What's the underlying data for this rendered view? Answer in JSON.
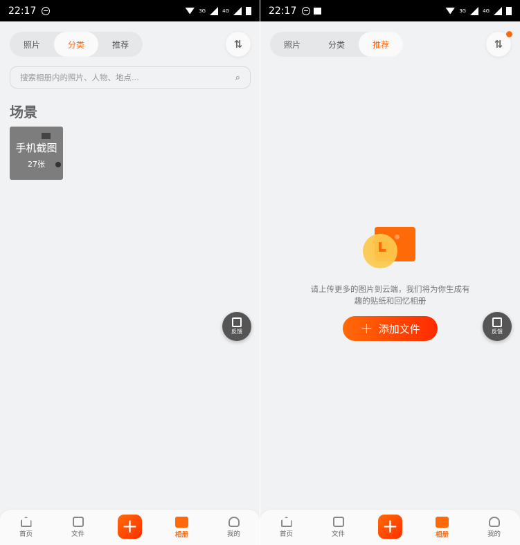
{
  "status": {
    "time": "22:17",
    "net1": "3G",
    "net2": "4G"
  },
  "tabs": [
    "照片",
    "分类",
    "推荐"
  ],
  "search": {
    "placeholder": "搜索相册内的照片、人物、地点..."
  },
  "category": {
    "section_title": "场景",
    "album_title": "手机截图",
    "album_count": "27张"
  },
  "recommend": {
    "message_line1": "请上传更多的图片到云端，我们将为你生成有",
    "message_line2": "趣的贴纸和回忆相册",
    "add_button": "添加文件"
  },
  "feedback": "反馈",
  "nav": [
    "首页",
    "文件",
    "相册",
    "我的"
  ],
  "accent": "#ff6a10"
}
